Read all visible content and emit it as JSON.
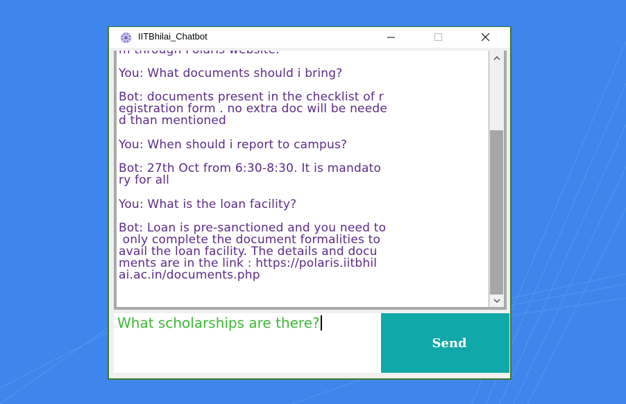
{
  "window": {
    "title": "IITBhilai_Chatbot",
    "controls": [
      "minimize-icon",
      "maximize-icon",
      "close-icon"
    ]
  },
  "chat": {
    "lines": [
      "m through Polaris website.",
      "You: What documents should i bring?",
      "Bot: documents present in the checklist of r",
      "egistration form . no extra doc will be neede",
      "d than mentioned",
      "You: When should i report to campus?",
      "Bot: 27th Oct from 6:30-8:30. It is mandato",
      "ry for all",
      "You: What is the loan facility?",
      "Bot: Loan is pre-sanctioned and you need to",
      " only complete the document formalities to",
      "avail the loan facility. The details and docu",
      "ments are in the link : https://polaris.iitbhil",
      "ai.ac.in/documents.php"
    ]
  },
  "input": {
    "value": "What scholarships are there?"
  },
  "send": {
    "label": "Send"
  },
  "colors": {
    "background": "#3f86ec",
    "message_text": "#5b2a86",
    "input_text": "#3cb935",
    "send_button": "#10a8a8"
  }
}
